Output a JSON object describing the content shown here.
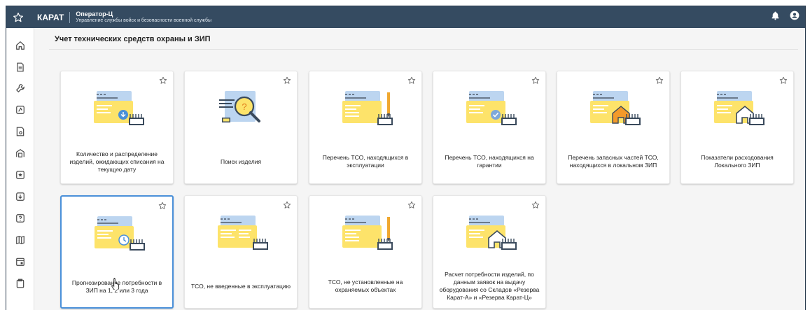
{
  "header": {
    "brand": "КАРАТ",
    "app_title": "Оператор-Ц",
    "app_subtitle": "Управление службы войск и безопасности военной службы"
  },
  "page": {
    "title": "Учет технических средств охраны и ЗИП"
  },
  "cards": [
    {
      "label": "Количество и распределение изделий, ожидающих списания на текущую дату",
      "icon": "download-doc-icon"
    },
    {
      "label": "Поиск изделия",
      "icon": "search-doc-icon"
    },
    {
      "label": "Перечень ТСО, находящихся в эксплуатации",
      "icon": "pen-doc-icon"
    },
    {
      "label": "Перечень ТСО, находящихся на гарантии",
      "icon": "check-doc-icon"
    },
    {
      "label": "Перечень запасных частей ТСО, находящихся в локальном ЗИП",
      "icon": "home-filled-doc-icon"
    },
    {
      "label": "Показатели расходования Локального ЗИП",
      "icon": "home-outline-doc-icon"
    },
    {
      "label": "Прогнозирование потребности в ЗИП на 1, 2 или 3 года",
      "icon": "clock-doc-icon"
    },
    {
      "label": "ТСО, не введенные в эксплуатацию",
      "icon": "list-doc-icon"
    },
    {
      "label": "ТСО, не установленные на охраняемых объектах",
      "icon": "pen-doc-icon"
    },
    {
      "label": "Расчет потребности изделий, по данным заявок на выдачу оборудования со Складов «Резерва Карат-А» и «Резерва Карат-Ц»",
      "icon": "home-outline-doc-icon"
    }
  ],
  "colors": {
    "header_bg": "#354b61",
    "doc_blue": "#bcd5f0",
    "doc_yellow": "#fde36a",
    "accent": "#4a90d9"
  }
}
